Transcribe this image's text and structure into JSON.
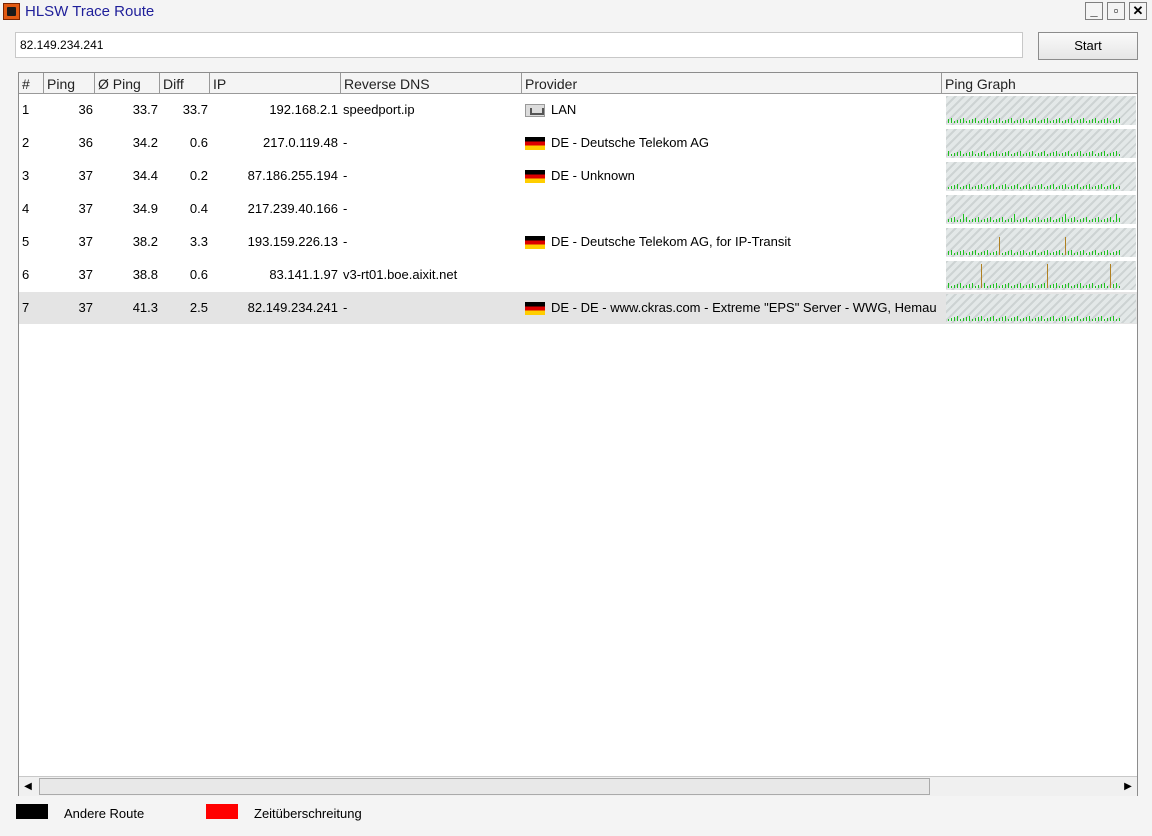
{
  "window": {
    "title": "HLSW Trace Route",
    "minimize": "_",
    "maximize": "▫",
    "close": "✕"
  },
  "address": {
    "value": "82.149.234.241"
  },
  "toolbar": {
    "start_label": "Start"
  },
  "table": {
    "columns": [
      "#",
      "Ping",
      "Ø Ping",
      "Diff",
      "IP",
      "Reverse DNS",
      "Provider",
      "Ping Graph"
    ],
    "rows": [
      {
        "hop": "1",
        "ping": "36",
        "avg": "33.7",
        "diff": "33.7",
        "ip": "192.168.2.1",
        "dns": "speedport.ip",
        "provider": "LAN",
        "flag": "lan-icon"
      },
      {
        "hop": "2",
        "ping": "36",
        "avg": "34.2",
        "diff": "0.6",
        "ip": "217.0.119.48",
        "dns": "-",
        "provider": "DE - Deutsche Telekom AG",
        "flag": "germany-flag-icon"
      },
      {
        "hop": "3",
        "ping": "37",
        "avg": "34.4",
        "diff": "0.2",
        "ip": "87.186.255.194",
        "dns": "-",
        "provider": "DE - Unknown",
        "flag": "germany-flag-icon"
      },
      {
        "hop": "4",
        "ping": "37",
        "avg": "34.9",
        "diff": "0.4",
        "ip": "217.239.40.166",
        "dns": "-",
        "provider": "",
        "flag": ""
      },
      {
        "hop": "5",
        "ping": "37",
        "avg": "38.2",
        "diff": "3.3",
        "ip": "193.159.226.13",
        "dns": "-",
        "provider": "DE - Deutsche Telekom AG, for IP-Transit",
        "flag": "germany-flag-icon"
      },
      {
        "hop": "6",
        "ping": "37",
        "avg": "38.8",
        "diff": "0.6",
        "ip": "83.141.1.97",
        "dns": "v3-rt01.boe.aixit.net",
        "provider": "",
        "flag": ""
      },
      {
        "hop": "7",
        "ping": "37",
        "avg": "41.3",
        "diff": "2.5",
        "ip": "82.149.234.241",
        "dns": "-",
        "provider": "DE - DE - www.ckras.com - Extreme \"EPS\" Server - WWG, Hemau",
        "flag": "germany-flag-icon",
        "selected": true
      }
    ]
  },
  "scrollbar": {
    "left": "◀",
    "right": "▶"
  },
  "legend": [
    {
      "label": "Andere Route",
      "color": "#000000"
    },
    {
      "label": "Zeitüberschreitung",
      "color": "#ff0000"
    }
  ]
}
